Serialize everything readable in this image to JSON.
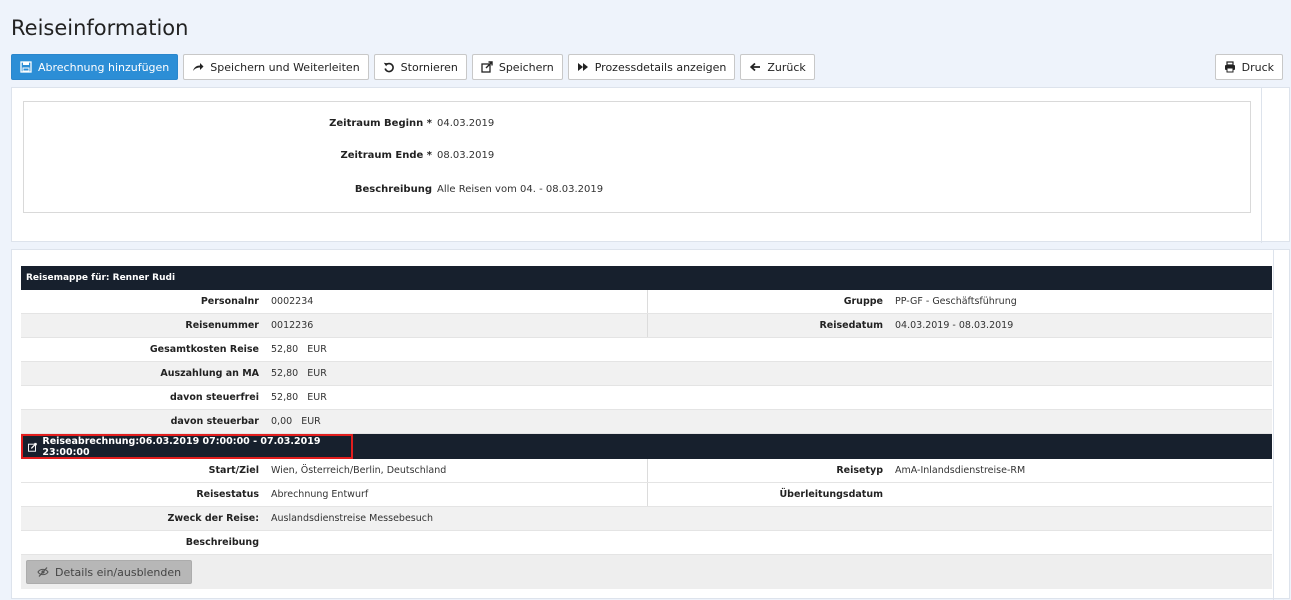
{
  "page": {
    "title": "Reiseinformation"
  },
  "toolbar": {
    "add_billing": "Abrechnung hinzufügen",
    "save_forward": "Speichern und Weiterleiten",
    "cancel": "Stornieren",
    "save": "Speichern",
    "process_details": "Prozessdetails anzeigen",
    "back": "Zurück",
    "print": "Druck"
  },
  "form": {
    "period_start": {
      "label": "Zeitraum Beginn *",
      "value": "04.03.2019"
    },
    "period_end": {
      "label": "Zeitraum Ende *",
      "value": "08.03.2019"
    },
    "description": {
      "label": "Beschreibung",
      "value": "Alle Reisen vom 04. - 08.03.2019"
    }
  },
  "folder": {
    "header": "Reisemappe für: Renner Rudi",
    "personalnr": {
      "label": "Personalnr",
      "value": "0002234"
    },
    "gruppe": {
      "label": "Gruppe",
      "value": "PP-GF - Geschäftsführung"
    },
    "reisenummer": {
      "label": "Reisenummer",
      "value": "0012236"
    },
    "reisedatum": {
      "label": "Reisedatum",
      "value": "04.03.2019 - 08.03.2019"
    },
    "gesamtkosten": {
      "label": "Gesamtkosten Reise",
      "value": "52,80   EUR"
    },
    "auszahlung": {
      "label": "Auszahlung an MA",
      "value": "52,80   EUR"
    },
    "steuerfrei": {
      "label": "davon steuerfrei",
      "value": "52,80   EUR"
    },
    "steuerbar": {
      "label": "davon steuerbar",
      "value": "0,00   EUR"
    }
  },
  "abrechnung": {
    "header": "Reiseabrechnung:06.03.2019 07:00:00 - 07.03.2019 23:00:00",
    "start_ziel": {
      "label": "Start/Ziel",
      "value": "Wien, Österreich/Berlin, Deutschland"
    },
    "reisetyp": {
      "label": "Reisetyp",
      "value": "AmA-Inlandsdienstreise-RM"
    },
    "reisestatus": {
      "label": "Reisestatus",
      "value": "Abrechnung Entwurf"
    },
    "ueberleitung": {
      "label": "Überleitungsdatum",
      "value": ""
    },
    "zweck": {
      "label": "Zweck der Reise:",
      "value": "Auslandsdienstreise Messebesuch"
    },
    "beschreibung": {
      "label": "Beschreibung",
      "value": ""
    },
    "details_button": "Details ein/ausblenden"
  },
  "colors": {
    "primary": "#2c8ed6",
    "dark_header": "#17202d",
    "highlight": "#e21e1e"
  }
}
